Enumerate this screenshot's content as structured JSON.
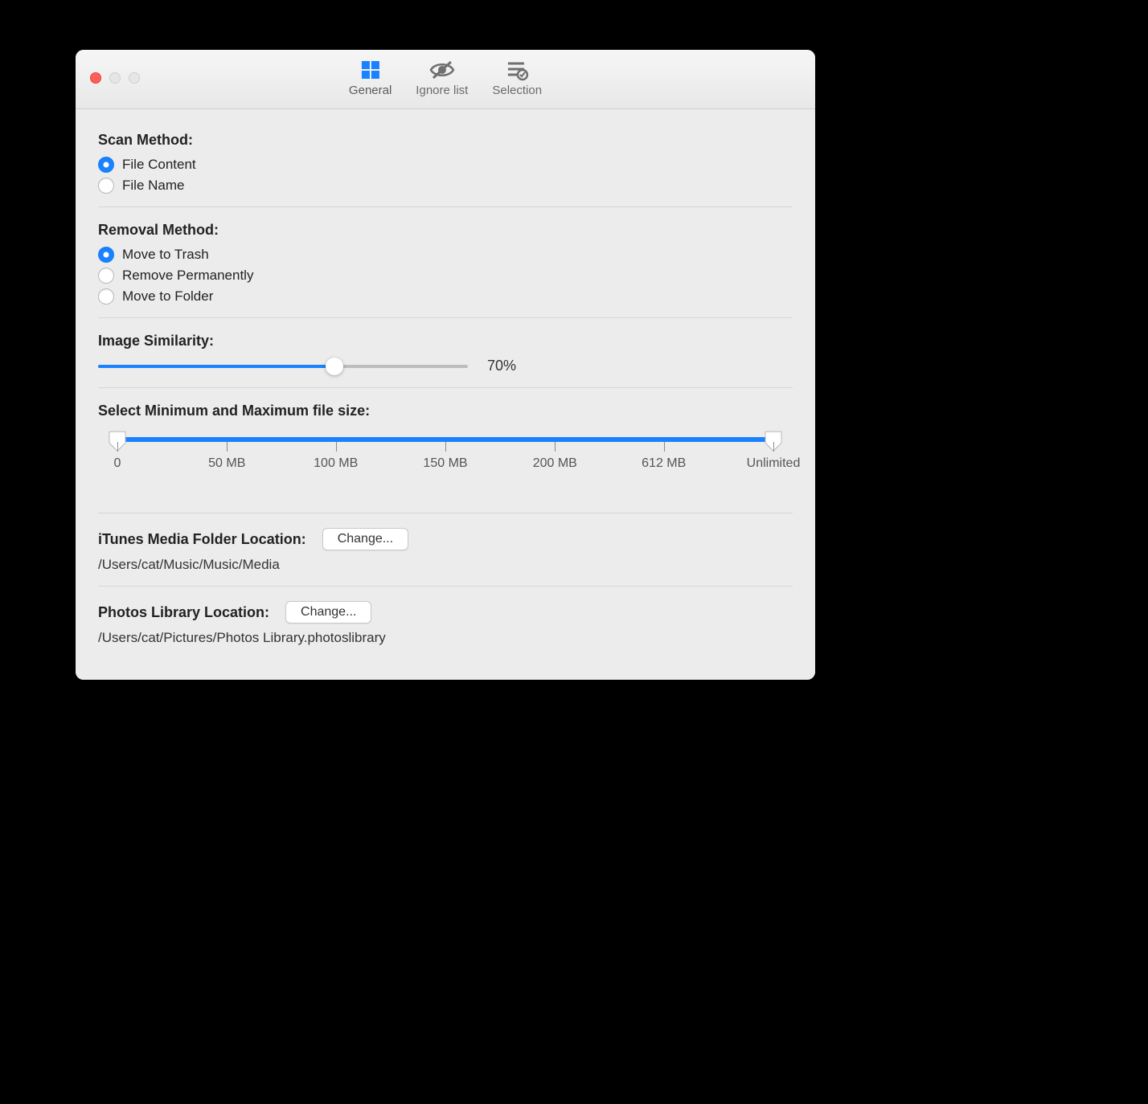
{
  "toolbar": {
    "tabs": [
      {
        "label": "General",
        "active": true
      },
      {
        "label": "Ignore list",
        "active": false
      },
      {
        "label": "Selection",
        "active": false
      }
    ]
  },
  "scan_method": {
    "title": "Scan Method:",
    "options": [
      {
        "label": "File Content",
        "checked": true
      },
      {
        "label": "File Name",
        "checked": false
      }
    ]
  },
  "removal_method": {
    "title": "Removal Method:",
    "options": [
      {
        "label": "Move to Trash",
        "checked": true
      },
      {
        "label": "Remove Permanently",
        "checked": false
      },
      {
        "label": "Move to Folder",
        "checked": false
      }
    ]
  },
  "image_similarity": {
    "title": "Image Similarity:",
    "value_text": "70%"
  },
  "file_size": {
    "title": "Select Minimum and Maximum file size:",
    "ticks": [
      {
        "pos": 0,
        "label": "0"
      },
      {
        "pos": 16.7,
        "label": "50 MB"
      },
      {
        "pos": 33.3,
        "label": "100 MB"
      },
      {
        "pos": 50,
        "label": "150 MB"
      },
      {
        "pos": 66.7,
        "label": "200 MB"
      },
      {
        "pos": 83.3,
        "label": "612 MB"
      },
      {
        "pos": 100,
        "label": "Unlimited"
      }
    ]
  },
  "itunes": {
    "title": "iTunes Media Folder Location:",
    "change_label": "Change...",
    "path": "/Users/cat/Music/Music/Media"
  },
  "photos": {
    "title": "Photos Library Location:",
    "change_label": "Change...",
    "path": "/Users/cat/Pictures/Photos Library.photoslibrary"
  }
}
